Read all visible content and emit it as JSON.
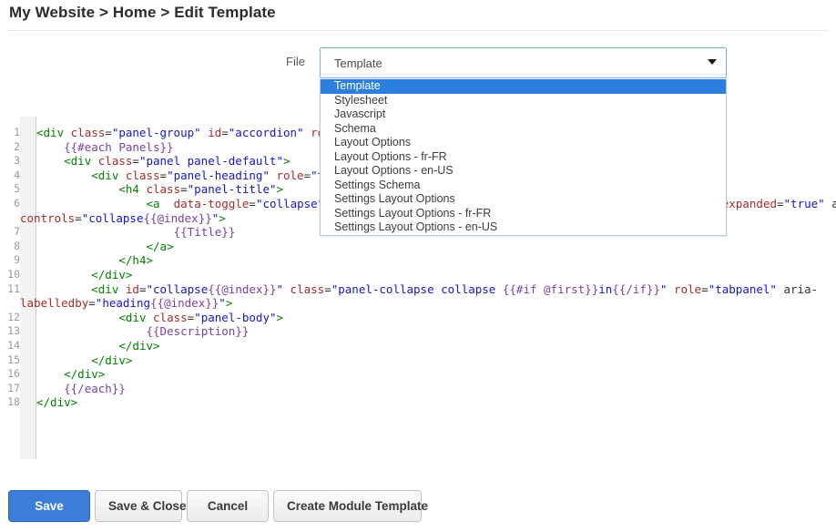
{
  "header": {
    "breadcrumb": "My Website > Home > Edit Template"
  },
  "file_selector": {
    "label": "File",
    "selected_value": "Template",
    "arrow_icon": "chevron-down-icon",
    "expanded": true,
    "options": [
      "Template",
      "Stylesheet",
      "Javascript",
      "Schema",
      "Layout Options",
      "Layout Options - fr-FR",
      "Layout Options - en-US",
      "Settings Schema",
      "Settings Layout Options",
      "Settings Layout Options - fr-FR",
      "Settings Layout Options - en-US"
    ]
  },
  "editor": {
    "language": "handlebars-html",
    "line_numbers": [
      1,
      2,
      3,
      4,
      5,
      6,
      7,
      8,
      9,
      10,
      11,
      12,
      13,
      14,
      15,
      16,
      17,
      18
    ],
    "lines": [
      {
        "number": "1",
        "text": "<div class=\"panel-group\" id=\"accordion\" role=\"tablist\" aria-multiselectable=\"true\">"
      },
      {
        "number": "2",
        "text": "    {{#each Panels}}"
      },
      {
        "number": "3",
        "text": "    <div class=\"panel panel-default\">"
      },
      {
        "number": "4",
        "text": "        <div class=\"panel-heading\" role=\"tab\" id=\"heading{{@index}}\">"
      },
      {
        "number": "5",
        "text": "            <h4 class=\"panel-title\">"
      },
      {
        "number": "6",
        "text": "                <a  data-toggle=\"collapse\" data-parent=\"#accordion\" href=\"#collapse{{@index}}\" aria-expanded=\"true\" aria-controls=\"collapse{{@index}}\">"
      },
      {
        "number": "7",
        "text": "                    {{Title}}"
      },
      {
        "number": "8",
        "text": "                </a>"
      },
      {
        "number": "9",
        "text": "            </h4>"
      },
      {
        "number": "10",
        "text": "        </div>"
      },
      {
        "number": "11",
        "text": "        <div id=\"collapse{{@index}}\" class=\"panel-collapse collapse {{#if @first}}in{{/if}}\" role=\"tabpanel\" aria-labelledby=\"heading{{@index}}\">"
      },
      {
        "number": "12",
        "text": "            <div class=\"panel-body\">"
      },
      {
        "number": "13",
        "text": "                {{Description}}"
      },
      {
        "number": "14",
        "text": "            </div>"
      },
      {
        "number": "15",
        "text": "        </div>"
      },
      {
        "number": "16",
        "text": "    </div>"
      },
      {
        "number": "17",
        "text": "    {{/each}}"
      },
      {
        "number": "18",
        "text": "</div>"
      }
    ],
    "line6_continuation": "controls=\"collapse{{@index}}\">",
    "line11_continuation": "labelledby=\"heading{{@index}}\">"
  },
  "buttons": {
    "save": "Save",
    "save_and_close": "Save & Close",
    "cancel": "Cancel",
    "create_module_template": "Create Module Template"
  },
  "colors": {
    "primary": "#3b7dd8",
    "dropdown_highlight": "#2a7fdf",
    "select_border": "#7ab0e0",
    "tag": "#008000",
    "attribute": "#a52a2a",
    "value": "#1414cc",
    "handlebars": "#7b3fa0"
  }
}
